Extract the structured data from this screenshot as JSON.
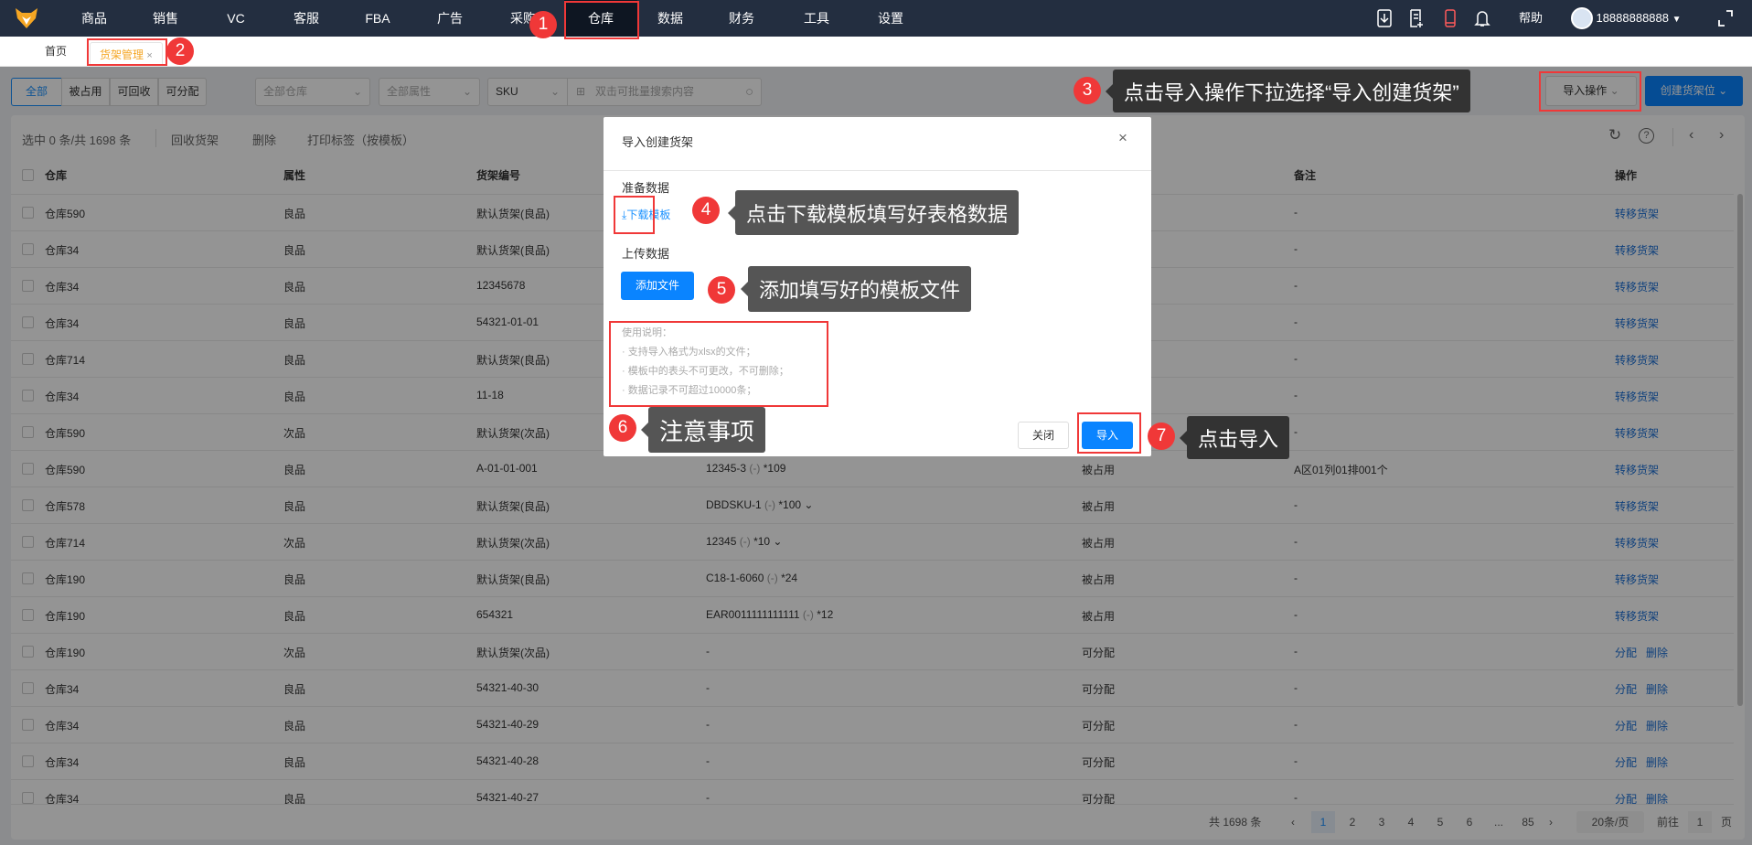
{
  "nav": {
    "items": [
      "商品",
      "销售",
      "VC",
      "客服",
      "FBA",
      "广告",
      "采购",
      "仓库",
      "数据",
      "财务",
      "工具",
      "设置"
    ],
    "active": "仓库",
    "help": "帮助",
    "user": "18888888888"
  },
  "tabs": {
    "home": "首页",
    "current": "货架管理",
    "close": "×"
  },
  "filters": {
    "segments": [
      "全部",
      "被占用",
      "可回收",
      "可分配"
    ],
    "warehouse": "全部仓库",
    "attribute": "全部属性",
    "field": "SKU",
    "search_placeholder": "双击可批量搜索内容"
  },
  "actions": {
    "import": "导入操作",
    "create": "创建货架位"
  },
  "toolbar": {
    "selected": "选中 0 条/共 1698 条",
    "recycle": "回收货架",
    "delete": "删除",
    "print": "打印标签（按模板）"
  },
  "table": {
    "headers": [
      "仓库",
      "属性",
      "货架编号",
      "",
      "",
      "备注",
      "操作"
    ],
    "rows": [
      [
        "仓库590",
        "良品",
        "默认货架(良品)",
        null,
        "",
        "-",
        [
          "转移货架"
        ]
      ],
      [
        "仓库34",
        "良品",
        "默认货架(良品)",
        null,
        "",
        "-",
        [
          "转移货架"
        ]
      ],
      [
        "仓库34",
        "良品",
        "12345678",
        null,
        "",
        "-",
        [
          "转移货架"
        ]
      ],
      [
        "仓库34",
        "良品",
        "54321-01-01",
        null,
        "",
        "-",
        [
          "转移货架"
        ]
      ],
      [
        "仓库714",
        "良品",
        "默认货架(良品)",
        null,
        "",
        "-",
        [
          "转移货架"
        ]
      ],
      [
        "仓库34",
        "良品",
        "11-18",
        null,
        "",
        "-",
        [
          "转移货架"
        ]
      ],
      [
        "仓库590",
        "次品",
        "默认货架(次品)",
        null,
        "",
        "-",
        [
          "转移货架"
        ]
      ],
      [
        "仓库590",
        "良品",
        "A-01-01-001",
        {
          "sku": "12345-3",
          "tag": "(-)",
          "qty": "*109",
          "expand": false
        },
        "被占用",
        "A区01列01排001个",
        [
          "转移货架"
        ]
      ],
      [
        "仓库578",
        "良品",
        "默认货架(良品)",
        {
          "sku": "DBDSKU-1",
          "tag": "(-)",
          "qty": "*100",
          "expand": true
        },
        "被占用",
        "-",
        [
          "转移货架"
        ]
      ],
      [
        "仓库714",
        "次品",
        "默认货架(次品)",
        {
          "sku": "12345",
          "tag": "(-)",
          "qty": "*10",
          "expand": true
        },
        "被占用",
        "-",
        [
          "转移货架"
        ]
      ],
      [
        "仓库190",
        "良品",
        "默认货架(良品)",
        {
          "sku": "C18-1-6060",
          "tag": "(-)",
          "qty": "*24",
          "expand": false
        },
        "被占用",
        "-",
        [
          "转移货架"
        ]
      ],
      [
        "仓库190",
        "良品",
        "654321",
        {
          "sku": "EAR0011111111111",
          "tag": "(-)",
          "qty": "*12",
          "expand": false
        },
        "被占用",
        "-",
        [
          "转移货架"
        ]
      ],
      [
        "仓库190",
        "次品",
        "默认货架(次品)",
        "-",
        "可分配",
        "-",
        [
          "分配",
          "删除"
        ]
      ],
      [
        "仓库34",
        "良品",
        "54321-40-30",
        "-",
        "可分配",
        "-",
        [
          "分配",
          "删除"
        ]
      ],
      [
        "仓库34",
        "良品",
        "54321-40-29",
        "-",
        "可分配",
        "-",
        [
          "分配",
          "删除"
        ]
      ],
      [
        "仓库34",
        "良品",
        "54321-40-28",
        "-",
        "可分配",
        "-",
        [
          "分配",
          "删除"
        ]
      ],
      [
        "仓库34",
        "良品",
        "54321-40-27",
        "-",
        "可分配",
        "-",
        [
          "分配",
          "删除"
        ]
      ]
    ]
  },
  "pagination": {
    "total": "共 1698 条",
    "pages": [
      "1",
      "2",
      "3",
      "4",
      "5",
      "6",
      "...",
      "85"
    ],
    "current": "1",
    "page_size": "20条/页",
    "goto": "前往",
    "goto_value": "1",
    "page_unit": "页"
  },
  "modal": {
    "title": "导入创建货架",
    "prepare": "准备数据",
    "download": "下载模板",
    "upload": "上传数据",
    "add_file": "添加文件",
    "notes_title": "使用说明：",
    "notes": [
      "支持导入格式为xlsx的文件；",
      "模板中的表头不可更改，不可删除；",
      "数据记录不可超过10000条；"
    ],
    "close": "关闭",
    "import": "导入"
  },
  "annotations": [
    {
      "n": "1"
    },
    {
      "n": "2"
    },
    {
      "n": "3",
      "text": "点击导入操作下拉选择“导入创建货架”"
    },
    {
      "n": "4",
      "text": "点击下载模板填写好表格数据"
    },
    {
      "n": "5",
      "text": "添加填写好的模板文件"
    },
    {
      "n": "6",
      "text": "注意事项"
    },
    {
      "n": "7",
      "text": "点击导入"
    }
  ],
  "colors": {
    "primary": "#0a84ff",
    "nav": "#232e40",
    "annotation": "#f03838",
    "link": "#1a6fd6"
  }
}
